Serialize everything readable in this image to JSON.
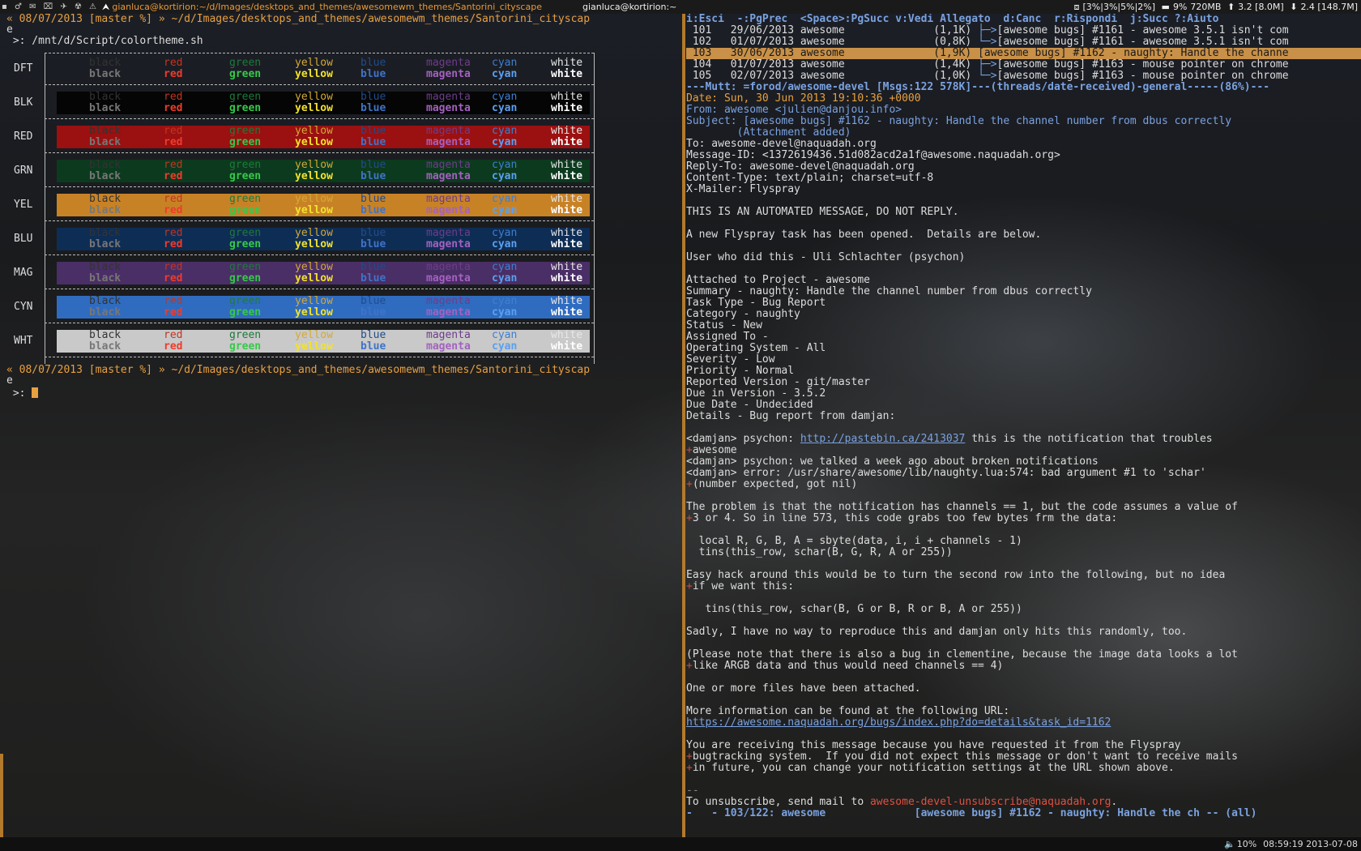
{
  "topbar": {
    "icons": "▪ ♂ ✉ ⌧ ✈ ☢ ⚠",
    "task_active": "gianluca@kortirion:~/d/Images/desktops_and_themes/awesomewm_themes/Santorini_cityscape",
    "task_other": "gianluca@kortirion:~",
    "stats": {
      "cpu": "[3%|3%|5%|2%]",
      "mem_pct": "9%",
      "mem": "720MB",
      "up": "3.2 [8.0M]",
      "down": "2.4 [148.7M]"
    }
  },
  "bottombar": {
    "volume": "10%",
    "clock": "08:59:19 2013-07-08"
  },
  "terminal": {
    "prompt1": "« 08/07/2013 [master %] » ~/d/Images/desktops_and_themes/awesomewm_themes/Santorini_cityscap",
    "prompt1_wrap": "e",
    "command": " >: /mnt/d/Script/colortheme.sh",
    "prompt2": "« 08/07/2013 [master %] » ~/d/Images/desktops_and_themes/awesomewm_themes/Santorini_cityscap",
    "prompt2_wrap": "e",
    "prompt_input": " >: "
  },
  "colortable": {
    "labels": [
      "DFT",
      "BLK",
      "RED",
      "GRN",
      "YEL",
      "BLU",
      "MAG",
      "CYN",
      "WHT"
    ],
    "bg_colors": [
      "transparent",
      "#050505",
      "#9b1010",
      "#0c3a1e",
      "#c88226",
      "#0e2d55",
      "#4a2e66",
      "#2f6cc0",
      "#c9c9c9"
    ],
    "color_names": [
      "black",
      "red",
      "green",
      "yellow",
      "blue",
      "magenta",
      "cyan",
      "white"
    ],
    "fg_normal": [
      "#333333",
      "#c23521",
      "#1e7a3a",
      "#d4a935",
      "#204c8c",
      "#6e3d8a",
      "#3d7fd0",
      "#e8e8e8"
    ],
    "fg_bold": [
      "#777777",
      "#ef3b2a",
      "#37c84a",
      "#f2e22c",
      "#3f73c8",
      "#a461c0",
      "#5aa0f0",
      "#ffffff"
    ]
  },
  "mutt": {
    "help": "i:Esci  -:PgPrec  <Space>:PgSucc v:Vedi Allegato  d:Canc  r:Rispondi  j:Succ ?:Aiuto",
    "index": [
      {
        "num": "101",
        "date": "29/06/2013",
        "from": "awesome",
        "size": "(1,1K)",
        "tree": "├─>",
        "subject": "[awesome bugs] #1161 - awesome 3.5.1 isn't com"
      },
      {
        "num": "102",
        "date": "01/07/2013",
        "from": "awesome",
        "size": "(0,8K)",
        "tree": "└─>",
        "subject": "[awesome bugs] #1161 - awesome 3.5.1 isn't com"
      },
      {
        "num": "103",
        "date": "30/06/2013",
        "from": "awesome",
        "size": "(1,9K)",
        "tree": "",
        "subject": "[awesome bugs] #1162 - naughty: Handle the channe"
      },
      {
        "num": "104",
        "date": "01/07/2013",
        "from": "awesome",
        "size": "(1,4K)",
        "tree": "├─>",
        "subject": "[awesome bugs] #1163 - mouse pointer on chrome"
      },
      {
        "num": "105",
        "date": "02/07/2013",
        "from": "awesome",
        "size": "(1,0K)",
        "tree": "└─>",
        "subject": "[awesome bugs] #1163 - mouse pointer on chrome"
      }
    ],
    "status_line": "---Mutt: =forod/awesome-devel [Msgs:122 578K]---(threads/date-received)-general-----(86%)---",
    "headers": {
      "date": "Date: Sun, 30 Jun 2013 19:10:36 +0000",
      "from": "From: awesome <julien@danjou.info>",
      "subject": "Subject: [awesome bugs] #1162 - naughty: Handle the channel number from dbus correctly",
      "attach": "        (Attachment added)",
      "to": "To: awesome-devel@naquadah.org",
      "msgid": "Message-ID: <1372619436.51d082acd2a1f@awesome.naquadah.org>",
      "replyto": "Reply-To: awesome-devel@naquadah.org",
      "ctype": "Content-Type: text/plain; charset=utf-8",
      "mailer": "X-Mailer: Flyspray"
    },
    "body": {
      "l1": "THIS IS AN AUTOMATED MESSAGE, DO NOT REPLY.",
      "l2": "A new Flyspray task has been opened.  Details are below.",
      "l3": "User who did this - Uli Schlachter (psychon)",
      "l4": "Attached to Project - awesome",
      "l5": "Summary - naughty: Handle the channel number from dbus correctly",
      "l6": "Task Type - Bug Report",
      "l7": "Category - naughty",
      "l8": "Status - New",
      "l9": "Assigned To -",
      "l10": "Operating System - All",
      "l11": "Severity - Low",
      "l12": "Priority - Normal",
      "l13": "Reported Version - git/master",
      "l14": "Due in Version - 3.5.2",
      "l15": "Due Date - Undecided",
      "l16": "Details - Bug report from damjan:",
      "l17a": "<damjan> psychon: ",
      "l17link": "http://pastebin.ca/2413037",
      "l17b": " this is the notification that troubles",
      "l18": "awesome",
      "l19": "<damjan> psychon: we talked a week ago about broken notifications",
      "l20": "<damjan> error: /usr/share/awesome/lib/naughty.lua:574: bad argument #1 to 'schar'",
      "l21": "(number expected, got nil)",
      "l22": "The problem is that the notification has channels == 1, but the code assumes a value of",
      "l23": "3 or 4. So in line 573, this code grabs too few bytes frm the data:",
      "l24": "  local R, G, B, A = sbyte(data, i, i + channels - 1)",
      "l25": "  tins(this_row, schar(B, G, R, A or 255))",
      "l26": "Easy hack around this would be to turn the second row into the following, but no idea",
      "l27": "if we want this:",
      "l28": "   tins(this_row, schar(B, G or B, R or B, A or 255))",
      "l29": "Sadly, I have no way to reproduce this and damjan only hits this randomly, too.",
      "l30": "(Please note that there is also a bug in clementine, because the image data looks a lot",
      "l31": "like ARGB data and thus would need channels == 4)",
      "l32": "One or more files have been attached.",
      "l33": "More information can be found at the following URL:",
      "l34": "https://awesome.naquadah.org/bugs/index.php?do=details&task_id=1162",
      "l35": "You are receiving this message because you have requested it from the Flyspray",
      "l36": "bugtracking system.  If you did not expect this message or don't want to receive mails",
      "l37": "in future, you can change your notification settings at the URL shown above.",
      "sig": "--",
      "unsub_a": "To unsubscribe, send mail to ",
      "unsub_addr": "awesome-devel-unsubscribe@naquadah.org",
      "unsub_b": "."
    },
    "pager_status": "-   - 103/122: awesome              [awesome bugs] #1162 - naughty: Handle the ch -- (all)"
  }
}
